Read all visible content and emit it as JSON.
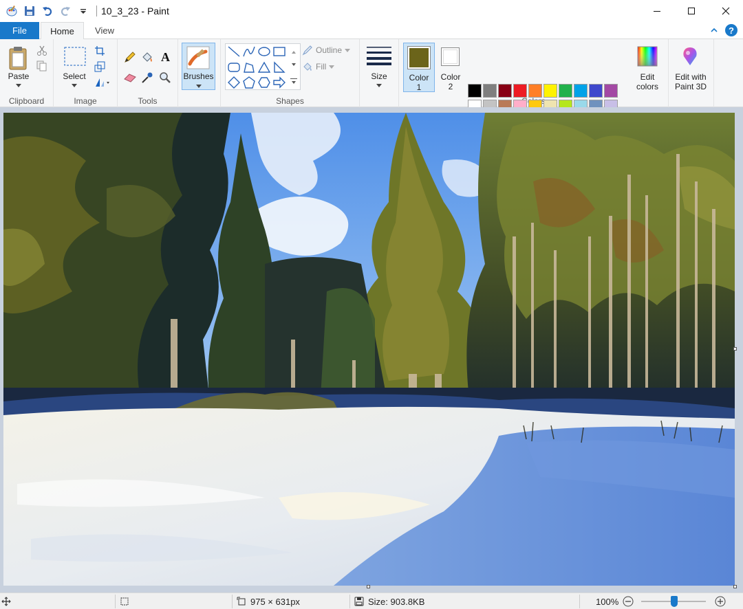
{
  "window": {
    "title": "10_3_23 - Paint"
  },
  "tabs": [
    {
      "label": "File"
    },
    {
      "label": "Home"
    },
    {
      "label": "View"
    }
  ],
  "ribbon": {
    "clipboard": {
      "group_label": "Clipboard",
      "paste_label": "Paste"
    },
    "image": {
      "group_label": "Image",
      "select_label": "Select"
    },
    "tools": {
      "group_label": "Tools"
    },
    "brushes": {
      "label": "Brushes"
    },
    "shapes": {
      "group_label": "Shapes",
      "outline_label": "Outline",
      "fill_label": "Fill"
    },
    "size": {
      "label": "Size"
    },
    "colors": {
      "group_label": "Colors",
      "color1_label": "Color",
      "color1_num": "1",
      "color2_label": "Color",
      "color2_num": "2",
      "color1_value": "#6b641a",
      "color2_value": "#ffffff",
      "edit_label_1": "Edit",
      "edit_label_2": "colors",
      "palette_row1": [
        "#000000",
        "#7f7f7f",
        "#880015",
        "#ed1c24",
        "#ff7f27",
        "#fff200",
        "#22b14c",
        "#00a2e8",
        "#3f48cc",
        "#a349a4"
      ],
      "palette_row2": [
        "#ffffff",
        "#c3c3c3",
        "#b97a57",
        "#ffaec9",
        "#ffc90e",
        "#efe4b0",
        "#b5e61d",
        "#99d9ea",
        "#7092be",
        "#c8bfe7"
      ],
      "palette_row3": [
        "#4a2d10",
        "#3d2008",
        "#e8c870",
        "#e0a868",
        "#ffffff",
        "#5b8ad8",
        "#f5f0d8",
        "#fff8e0",
        "#101418",
        "#6b641a"
      ]
    },
    "paint3d": {
      "label_1": "Edit with",
      "label_2": "Paint 3D"
    }
  },
  "status": {
    "dimensions": "975 × 631px",
    "size": "Size: 903.8KB",
    "zoom": "100%"
  }
}
